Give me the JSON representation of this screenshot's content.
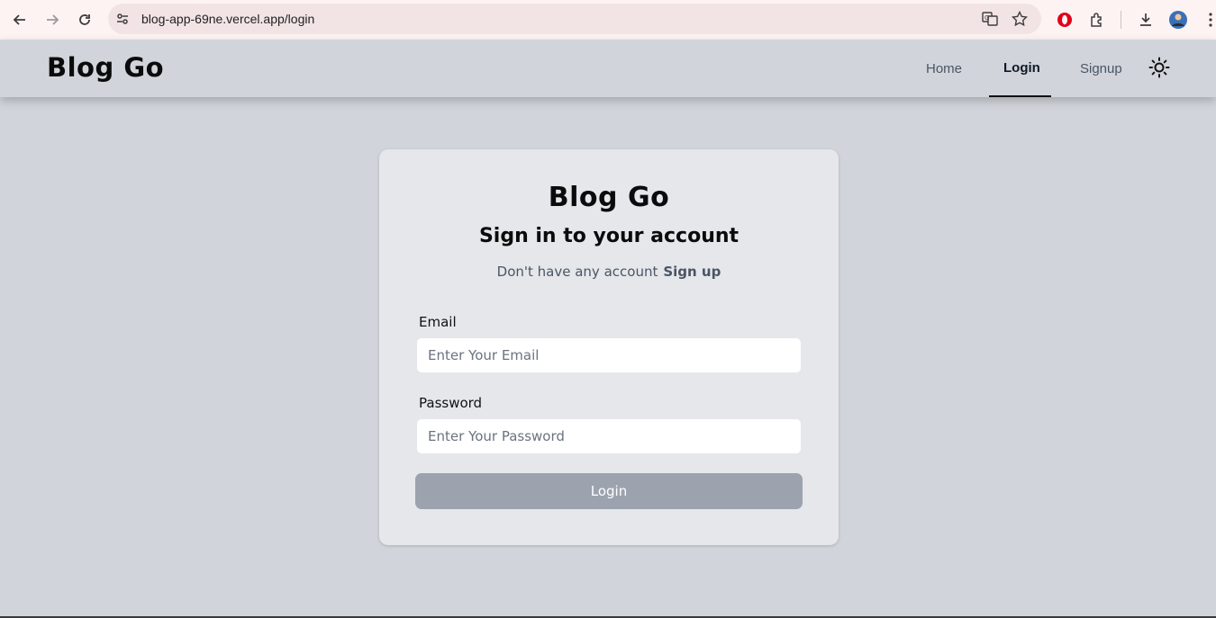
{
  "browser": {
    "url": "blog-app-69ne.vercel.app/login"
  },
  "header": {
    "logo": "Blog Go",
    "nav": [
      {
        "label": "Home",
        "active": false
      },
      {
        "label": "Login",
        "active": true
      },
      {
        "label": "Signup",
        "active": false
      }
    ],
    "theme_icon": "sun-icon"
  },
  "card": {
    "logo": "Blog Go",
    "heading": "Sign in to your account",
    "sub_text": "Don't have any account",
    "signup_link": "Sign up",
    "email": {
      "label": "Email",
      "placeholder": "Enter Your Email",
      "value": ""
    },
    "password": {
      "label": "Password",
      "placeholder": "Enter Your Password",
      "value": ""
    },
    "submit_label": "Login"
  },
  "colors": {
    "page_bg": "#d1d5db",
    "card_bg": "#e5e7eb",
    "button_bg": "#9ca3af",
    "browser_bar": "#fdf3f3"
  }
}
